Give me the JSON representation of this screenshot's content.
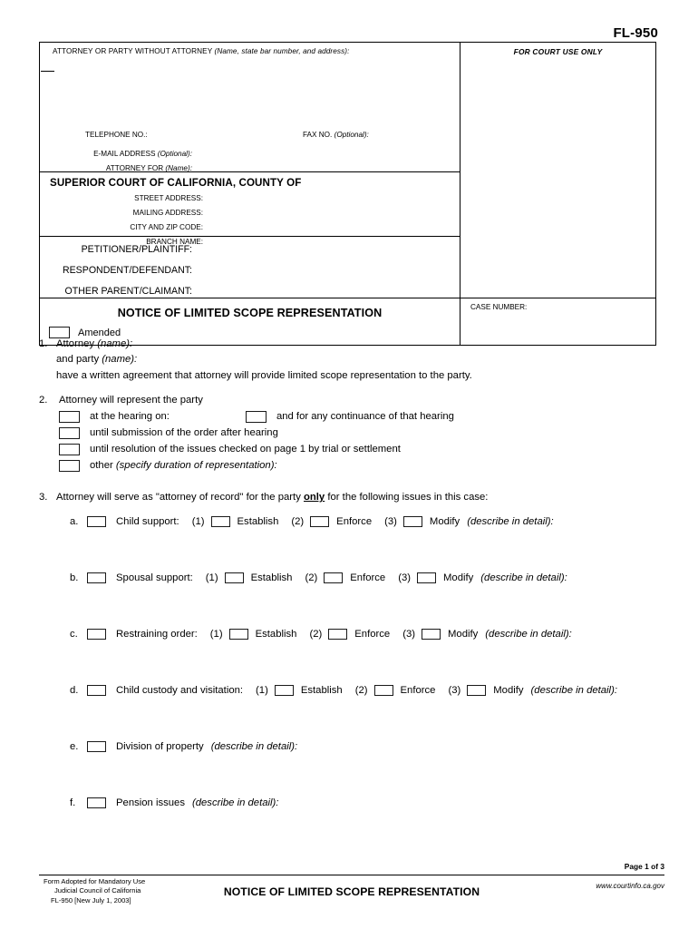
{
  "form": {
    "number": "FL-950",
    "title": "NOTICE OF LIMITED SCOPE REPRESENTATION"
  },
  "caption": {
    "attorney_label": "ATTORNEY OR PARTY WITHOUT ATTORNEY",
    "attorney_label_italic": "(Name, state bar number, and address):",
    "telephone_label": "TELEPHONE NO.:",
    "fax_label": "FAX NO.",
    "fax_label_italic": "(Optional):",
    "email_label": "E-MAIL ADDRESS",
    "email_label_italic": "(Optional):",
    "attorney_for_label": "ATTORNEY FOR",
    "attorney_for_italic": "(Name):",
    "for_court_use_only": "FOR COURT USE ONLY",
    "court_title": "SUPERIOR COURT OF CALIFORNIA, COUNTY OF",
    "street_address_label": "STREET ADDRESS:",
    "mailing_address_label": "MAILING ADDRESS:",
    "city_zip_label": "CITY AND ZIP CODE:",
    "branch_name_label": "BRANCH NAME:",
    "petitioner_label": "PETITIONER/PLAINTIFF:",
    "respondent_label": "RESPONDENT/DEFENDANT:",
    "other_parent_label": "OTHER PARENT/CLAIMANT:",
    "amended_label": "Amended",
    "case_number_label": "CASE NUMBER:"
  },
  "items": {
    "item1": {
      "number": "1.",
      "line1_text": "Attorney ",
      "line1_italic": "(name):",
      "line2_text": "and party ",
      "line2_italic": "(name):",
      "line3": "have a written agreement that attorney will provide limited scope representation to the party."
    },
    "item2": {
      "number": "2.",
      "heading": "Attorney will represent the party",
      "option_a": "at the hearing on:",
      "option_a_continuance": "and for any continuance of that hearing",
      "option_b": "until submission of the order after hearing",
      "option_c": "until resolution of the issues checked on page 1 by trial or settlement",
      "option_d_text": "other ",
      "option_d_italic": "(specify duration of representation):"
    },
    "item3": {
      "number": "3.",
      "heading_pre": "Attorney will serve as \"attorney of record\" for the party ",
      "heading_bold": "only",
      "heading_post": " for the following issues in this case:",
      "sub_labels": {
        "n1": "(1)",
        "n2": "(2)",
        "n3": "(3)",
        "establish": "Establish",
        "enforce": "Enforce",
        "modify": "Modify",
        "describe": "(describe in detail):"
      },
      "rows": [
        {
          "letter": "a.",
          "name": "Child support:",
          "has_subs": true
        },
        {
          "letter": "b.",
          "name": "Spousal support:",
          "has_subs": true
        },
        {
          "letter": "c.",
          "name": "Restraining order:",
          "has_subs": true
        },
        {
          "letter": "d.",
          "name": "Child custody and visitation:",
          "has_subs": true
        },
        {
          "letter": "e.",
          "name": "Division of property",
          "has_subs": false
        },
        {
          "letter": "f.",
          "name": "Pension issues",
          "has_subs": false
        }
      ]
    }
  },
  "footer": {
    "page_of": "Page 1 of 3",
    "adopted_line1": "Form Adopted for Mandatory Use",
    "adopted_line2": "Judicial Council of California",
    "adopted_line3": "FL-950 [New July 1, 2003]",
    "center_title": "NOTICE OF LIMITED SCOPE REPRESENTATION",
    "website": "www.courtinfo.ca.gov"
  }
}
